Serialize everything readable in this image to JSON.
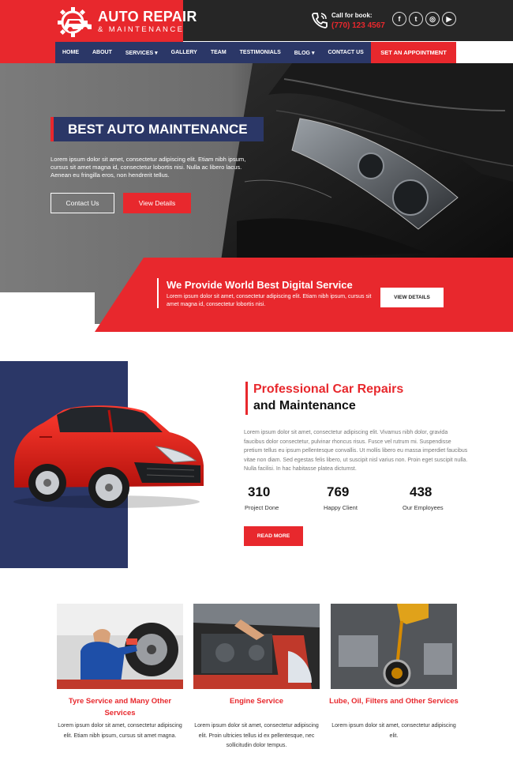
{
  "brand": {
    "title": "AUTO REPAIR",
    "subtitle": "& MAINTENANCE"
  },
  "contact": {
    "label": "Call for book:",
    "phone": "(770) 123 4567"
  },
  "social": [
    {
      "icon": "facebook-icon",
      "glyph": "f"
    },
    {
      "icon": "twitter-icon",
      "glyph": "t"
    },
    {
      "icon": "instagram-icon",
      "glyph": "◎"
    },
    {
      "icon": "youtube-icon",
      "glyph": "▶"
    }
  ],
  "nav": {
    "items": [
      "HOME",
      "ABOUT",
      "SERVICES ▾",
      "GALLERY",
      "TEAM",
      "TESTIMONIALS",
      "BLOG ▾",
      "CONTACT US"
    ],
    "cta": "SET AN APPOINTMENT"
  },
  "hero": {
    "title": "BEST AUTO MAINTENANCE",
    "text": "Lorem ipsum dolor sit amet, consectetur adipiscing elit. Etiam nibh ipsum, cursus sit amet magna id, consectetur lobortis nisi. Nulla ac libero lacus. Aenean eu fringilla eros, non hendrerit tellus.",
    "btn_contact": "Contact Us",
    "btn_details": "View Details"
  },
  "band": {
    "title": "We Provide World Best Digital Service",
    "text": "Lorem ipsum dolor sit amet, consectetur adipiscing elit. Etiam nibh ipsum, cursus sit amet magna id, consectetur lobortis nisi.",
    "button": "VIEW DETAILS"
  },
  "about": {
    "title_red": "Professional Car Repairs",
    "title_black": "and Maintenance",
    "text": "Lorem ipsum dolor sit amet, consectetur adipiscing elit. Vivamus nibh dolor, gravida faucibus dolor consectetur, pulvinar rhoncus risus. Fusce vel rutrum mi. Suspendisse pretium tellus eu ipsum pellentesque convallis. Ut mollis libero eu massa imperdiet faucibus vitae non diam. Sed egestas felis libero, ut suscipit nisl varius non. Proin eget suscipit nulla. Nulla facilisi. In hac habitasse platea dictumst.",
    "stats": [
      {
        "value": "310",
        "label": "Project Done"
      },
      {
        "value": "769",
        "label": "Happy Client"
      },
      {
        "value": "438",
        "label": "Our Employees"
      }
    ],
    "button": "READ MORE"
  },
  "services": [
    {
      "title": "Tyre Service and Many Other Services",
      "text": "Lorem ipsum dolor sit amet, consectetur adipiscing elit. Etiam nibh ipsum, cursus sit amet magna."
    },
    {
      "title": "Engine Service",
      "text": "Lorem ipsum dolor sit amet, consectetur adipiscing elit. Proin ultricies tellus id ex pellentesque, nec sollicitudin dolor tempus."
    },
    {
      "title": "Lube, Oil, Filters and Other Services",
      "text": "Lorem ipsum dolor sit amet, consectetur adipiscing elit."
    }
  ],
  "colors": {
    "accent_red": "#e8282d",
    "navy": "#2b3767",
    "dark": "#262626"
  }
}
